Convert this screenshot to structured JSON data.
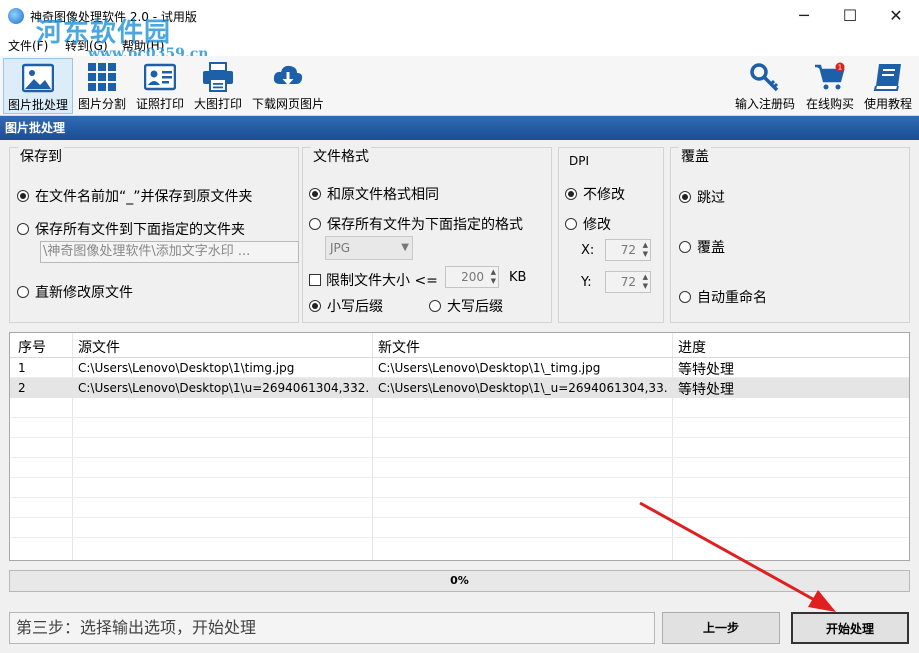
{
  "window": {
    "title": "神奇图像处理软件 2.0 - 试用版",
    "min": "─",
    "max": "☐",
    "close": "✕"
  },
  "watermark": {
    "text": "河东软件园",
    "url": "www.pc0359.cn"
  },
  "menu": [
    {
      "label": "文件(F)"
    },
    {
      "label": "转到(G)"
    },
    {
      "label": "帮助(H)"
    }
  ],
  "toolbar": {
    "left": [
      {
        "label": "图片批处理",
        "icon": "image-icon"
      },
      {
        "label": "图片分割",
        "icon": "grid-icon"
      },
      {
        "label": "证照打印",
        "icon": "id-card-icon"
      },
      {
        "label": "大图打印",
        "icon": "printer-icon"
      },
      {
        "label": "下载网页图片",
        "icon": "cloud-download-icon"
      }
    ],
    "right": [
      {
        "label": "输入注册码",
        "icon": "key-icon"
      },
      {
        "label": "在线购买",
        "icon": "cart-icon",
        "badge": "1"
      },
      {
        "label": "使用教程",
        "icon": "book-icon"
      }
    ]
  },
  "section_title": "图片批处理",
  "save": {
    "title": "保存到",
    "opt1": "在文件名前加“_”并保存到原文件夹",
    "opt2": "保存所有文件到下面指定的文件夹",
    "path": "\\神奇图像处理软件\\添加文字水印 ...",
    "opt3": "直新修改原文件"
  },
  "format": {
    "title": "文件格式",
    "opt1": "和原文件格式相同",
    "opt2": "保存所有文件为下面指定的格式",
    "select": "JPG",
    "limit_label": "限制文件大小 <=",
    "limit_value": "200",
    "limit_unit": "KB",
    "lower": "小写后缀",
    "upper": "大写后缀"
  },
  "dpi": {
    "title": "DPI",
    "opt1": "不修改",
    "opt2": "修改",
    "x_label": "X:",
    "x_value": "72",
    "y_label": "Y:",
    "y_value": "72"
  },
  "overwrite": {
    "title": "覆盖",
    "opt1": "跳过",
    "opt2": "覆盖",
    "opt3": "自动重命名"
  },
  "table": {
    "headers": [
      "序号",
      "源文件",
      "新文件",
      "进度"
    ],
    "rows": [
      [
        "1",
        "C:\\Users\\Lenovo\\Desktop\\1\\timg.jpg",
        "C:\\Users\\Lenovo\\Desktop\\1\\_timg.jpg",
        "等特处理"
      ],
      [
        "2",
        "C:\\Users\\Lenovo\\Desktop\\1\\u=2694061304,332...",
        "C:\\Users\\Lenovo\\Desktop\\1\\_u=2694061304,33...",
        "等特处理"
      ]
    ]
  },
  "progress": {
    "value": 0,
    "text": "0%",
    "color": "#40a040"
  },
  "status": "第三步：选择输出选项，开始处理",
  "buttons": {
    "prev": "上一步",
    "start": "开始处理"
  },
  "colors": {
    "header": "#1b4e93",
    "arrow": "#e02020"
  }
}
